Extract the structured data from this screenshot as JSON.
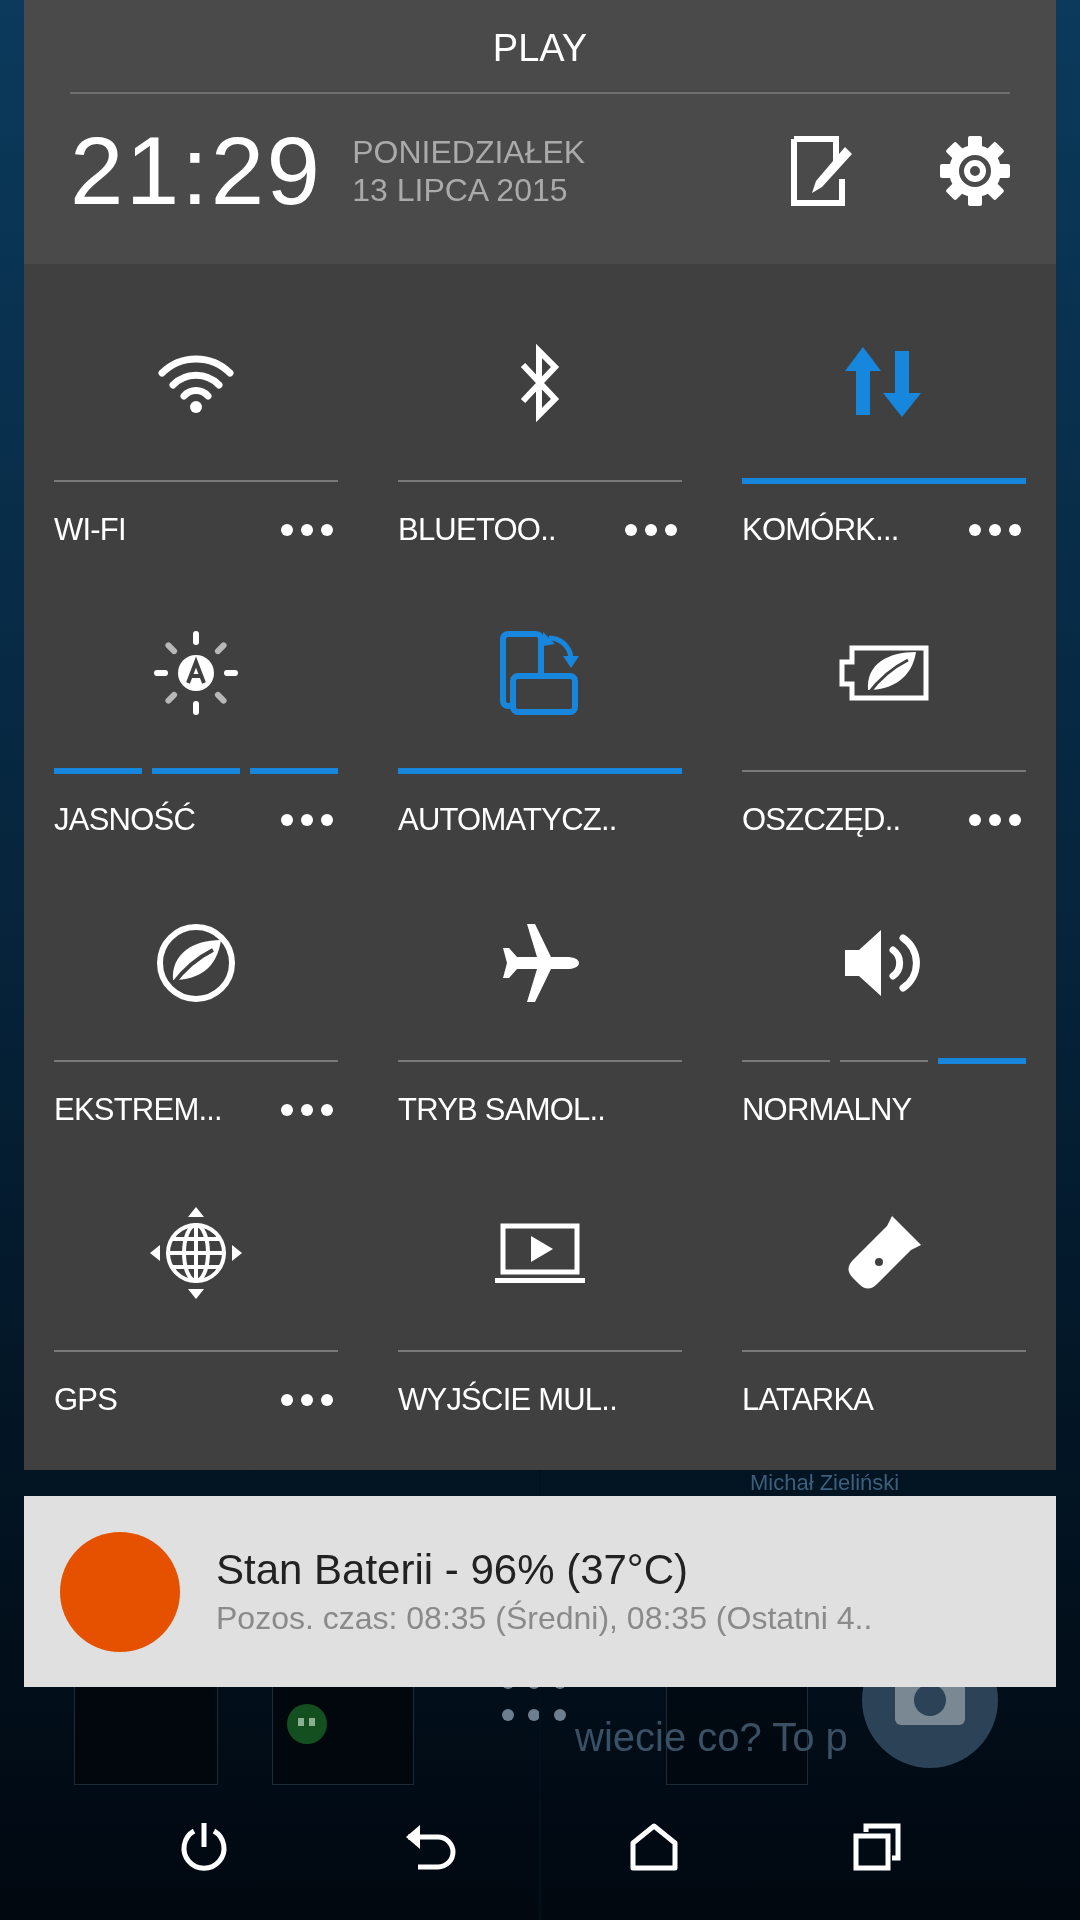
{
  "header": {
    "operator": "PLAY",
    "time": "21:29",
    "day": "PONIEDZIAŁEK",
    "date": "13 LIPCA 2015"
  },
  "tiles": [
    {
      "label": "WI-FI",
      "on": false,
      "more": true
    },
    {
      "label": "BLUETOO..",
      "on": false,
      "more": true
    },
    {
      "label": "KOMÓRK...",
      "on": true,
      "more": true
    },
    {
      "label": "JASNOŚĆ",
      "kind": "segments",
      "segments": [
        true,
        true,
        true
      ],
      "more": true
    },
    {
      "label": "AUTOMATYCZ..",
      "on": true,
      "more": false
    },
    {
      "label": "OSZCZĘD..",
      "on": false,
      "more": true
    },
    {
      "label": "EKSTREM...",
      "on": false,
      "more": true
    },
    {
      "label": "TRYB SAMOL..",
      "on": false,
      "more": false
    },
    {
      "label": "NORMALNY",
      "kind": "segments",
      "segments": [
        false,
        false,
        true
      ],
      "more": false
    },
    {
      "label": "GPS",
      "on": false,
      "more": true
    },
    {
      "label": "WYJŚCIE MUL..",
      "on": false,
      "more": false
    },
    {
      "label": "LATARKA",
      "on": false,
      "more": false
    }
  ],
  "background": {
    "contact": "Michał Zieliński",
    "post": "wiecie co? To p"
  },
  "notification": {
    "color": "#e65100",
    "title": "Stan Baterii - 96% (37°C)",
    "text": "Pozos. czas: 08:35 (Średni), 08:35 (Ostatni 4.."
  }
}
